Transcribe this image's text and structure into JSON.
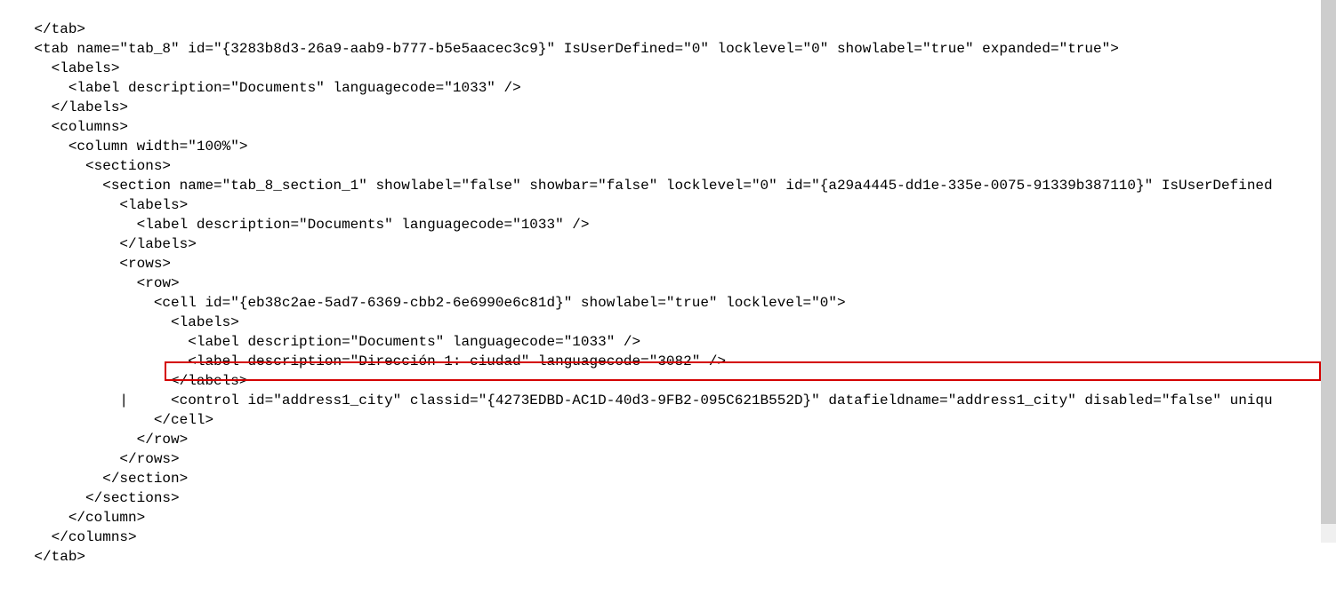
{
  "lines": {
    "l0": "    </tab>",
    "l1": "    <tab name=\"tab_8\" id=\"{3283b8d3-26a9-aab9-b777-b5e5aacec3c9}\" IsUserDefined=\"0\" locklevel=\"0\" showlabel=\"true\" expanded=\"true\">",
    "l2": "      <labels>",
    "l3": "        <label description=\"Documents\" languagecode=\"1033\" />",
    "l4": "      </labels>",
    "l5": "      <columns>",
    "l6": "        <column width=\"100%\">",
    "l7": "          <sections>",
    "l8": "            <section name=\"tab_8_section_1\" showlabel=\"false\" showbar=\"false\" locklevel=\"0\" id=\"{a29a4445-dd1e-335e-0075-91339b387110}\" IsUserDefined",
    "l9": "              <labels>",
    "l10": "                <label description=\"Documents\" languagecode=\"1033\" />",
    "l11": "              </labels>",
    "l12": "              <rows>",
    "l13": "                <row>",
    "l14": "                  <cell id=\"{eb38c2ae-5ad7-6369-cbb2-6e6990e6c81d}\" showlabel=\"true\" locklevel=\"0\">",
    "l15": "                    <labels>",
    "l16": "                      <label description=\"Documents\" languagecode=\"1033\" />",
    "l17": "                      <label description=\"Dirección 1: ciudad\" languagecode=\"3082\" />",
    "l18": "                    </labels>",
    "l19": "              |     <control id=\"address1_city\" classid=\"{4273EDBD-AC1D-40d3-9FB2-095C621B552D}\" datafieldname=\"address1_city\" disabled=\"false\" uniqu",
    "l20": "                  </cell>",
    "l21": "                </row>",
    "l22": "              </rows>",
    "l23": "            </section>",
    "l24": "          </sections>",
    "l25": "        </column>",
    "l26": "      </columns>",
    "l27": "    </tab>"
  }
}
